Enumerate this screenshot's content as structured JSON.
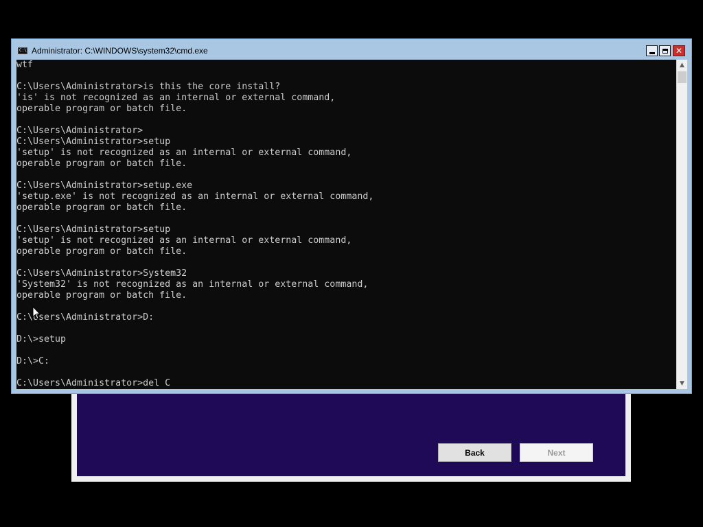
{
  "cmd_window": {
    "title": "Administrator: C:\\WINDOWS\\system32\\cmd.exe",
    "icon_label": "C:\\",
    "close_glyph": "✕"
  },
  "console": {
    "lines": [
      "wtf",
      "",
      "C:\\Users\\Administrator>is this the core install?",
      "'is' is not recognized as an internal or external command,",
      "operable program or batch file.",
      "",
      "C:\\Users\\Administrator>",
      "C:\\Users\\Administrator>setup",
      "'setup' is not recognized as an internal or external command,",
      "operable program or batch file.",
      "",
      "C:\\Users\\Administrator>setup.exe",
      "'setup.exe' is not recognized as an internal or external command,",
      "operable program or batch file.",
      "",
      "C:\\Users\\Administrator>setup",
      "'setup' is not recognized as an internal or external command,",
      "operable program or batch file.",
      "",
      "C:\\Users\\Administrator>System32",
      "'System32' is not recognized as an internal or external command,",
      "operable program or batch file.",
      "",
      "C:\\Users\\Administrator>D:",
      "",
      "D:\\>setup",
      "",
      "D:\\>C:",
      "",
      "C:\\Users\\Administrator>del C"
    ]
  },
  "scrollbar": {
    "up_glyph": "▲",
    "down_glyph": "▼"
  },
  "setup_dialog": {
    "back_label": "Back",
    "next_label": "Next"
  },
  "colors": {
    "console_background": "#0c0c0c",
    "console_text": "#cccccc",
    "setup_background": "#1f0a57",
    "close_button": "#c9302c"
  }
}
